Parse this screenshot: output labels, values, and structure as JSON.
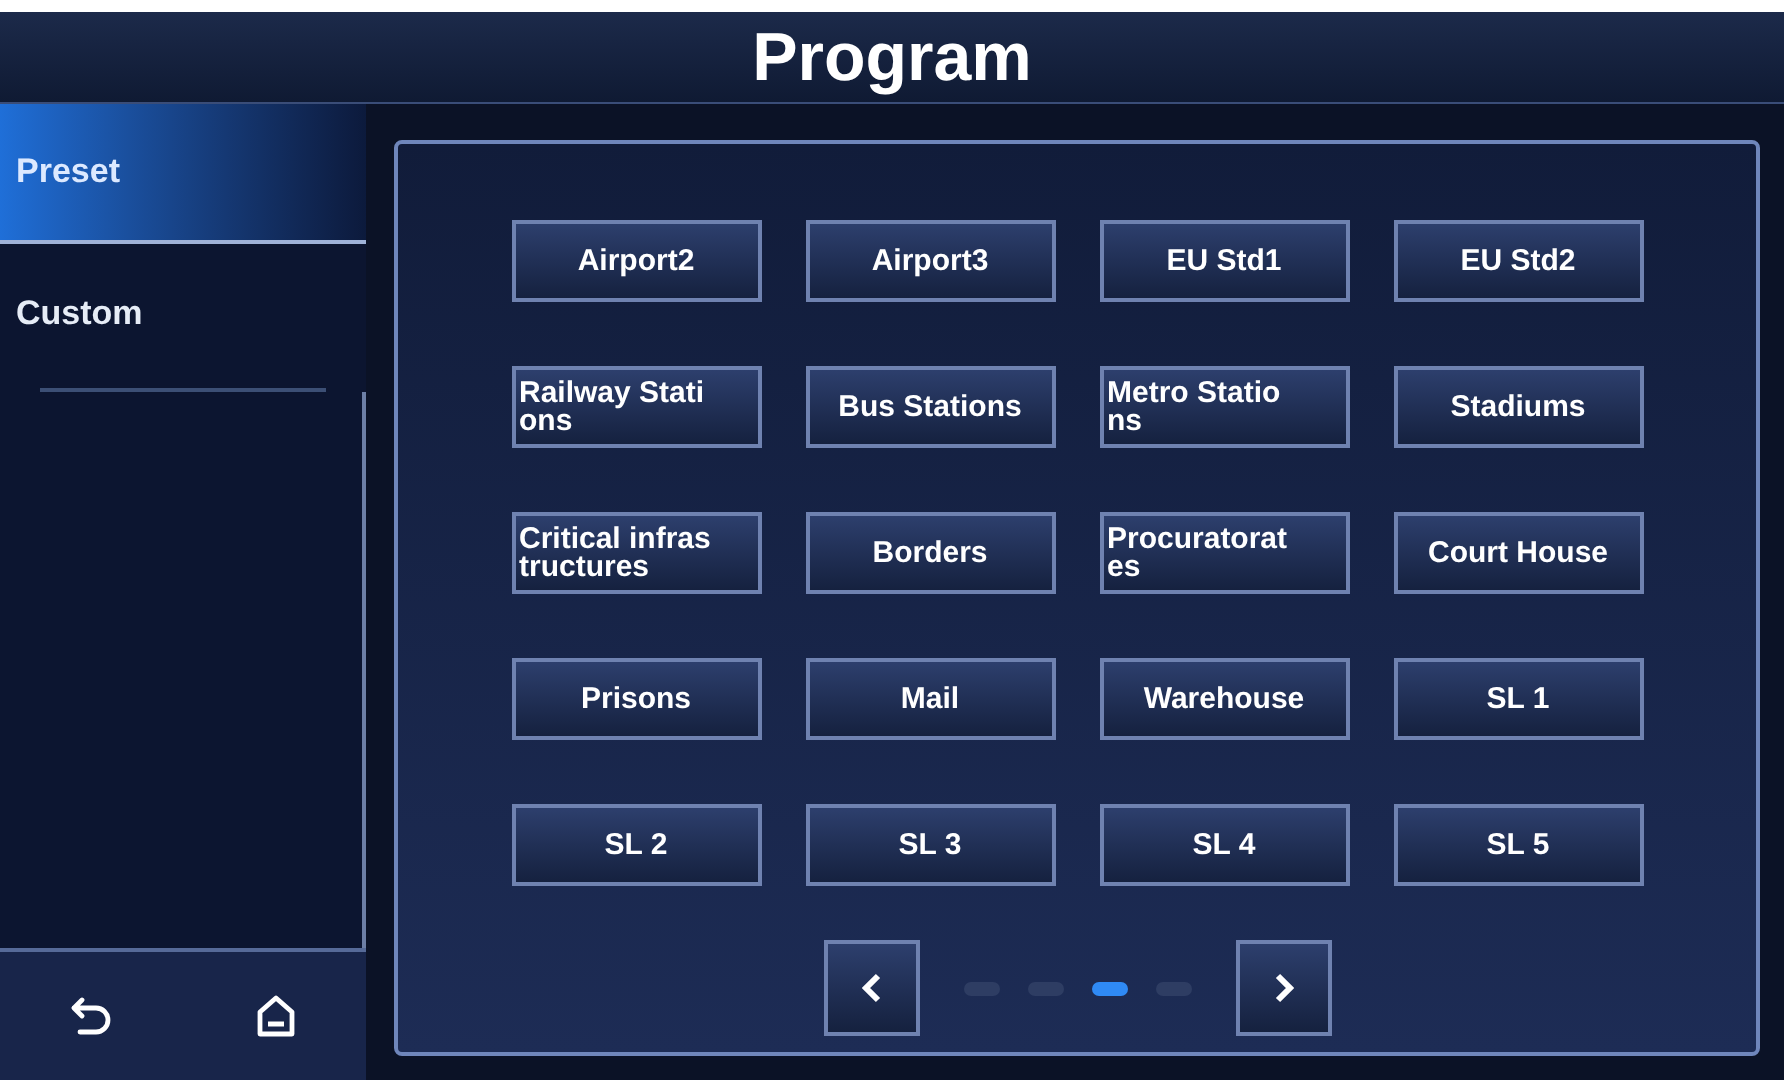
{
  "title": "Program",
  "sidebar": {
    "items": [
      {
        "label": "Preset",
        "selected": true
      },
      {
        "label": "Custom",
        "selected": false
      }
    ]
  },
  "programs": [
    {
      "lines": [
        "Airport2"
      ]
    },
    {
      "lines": [
        "Airport3"
      ]
    },
    {
      "lines": [
        "EU Std1"
      ]
    },
    {
      "lines": [
        "EU Std2"
      ]
    },
    {
      "lines": [
        "Railway Stati",
        "ons"
      ]
    },
    {
      "lines": [
        "Bus Stations"
      ]
    },
    {
      "lines": [
        "Metro Statio",
        "ns"
      ]
    },
    {
      "lines": [
        "Stadiums"
      ]
    },
    {
      "lines": [
        "Critical infras",
        "tructures"
      ]
    },
    {
      "lines": [
        "Borders"
      ]
    },
    {
      "lines": [
        "Procuratorat",
        "es"
      ]
    },
    {
      "lines": [
        "Court House"
      ]
    },
    {
      "lines": [
        "Prisons"
      ]
    },
    {
      "lines": [
        "Mail"
      ]
    },
    {
      "lines": [
        "Warehouse"
      ]
    },
    {
      "lines": [
        "SL 1"
      ]
    },
    {
      "lines": [
        "SL 2"
      ]
    },
    {
      "lines": [
        "SL 3"
      ]
    },
    {
      "lines": [
        "SL 4"
      ]
    },
    {
      "lines": [
        "SL 5"
      ]
    }
  ],
  "pager": {
    "pages": [
      {
        "selected": false
      },
      {
        "selected": false
      },
      {
        "selected": true
      },
      {
        "selected": false
      }
    ]
  }
}
